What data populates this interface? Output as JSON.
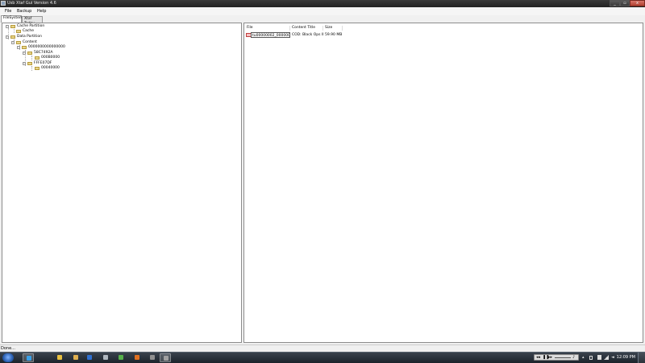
{
  "window": {
    "title": "Usb Xtaf Gui Version 4.6"
  },
  "menu": [
    "File",
    "Backup",
    "Help"
  ],
  "tabs": [
    "FileSystem",
    "Xtaf Today"
  ],
  "tree": [
    {
      "label": "Cache Partition"
    },
    {
      "label": "Cache"
    },
    {
      "label": "Data Partition"
    },
    {
      "label": "Content"
    },
    {
      "label": "0000000000000000"
    },
    {
      "label": "58C7492A"
    },
    {
      "label": "000B0000"
    },
    {
      "label": "FFFE07DF"
    },
    {
      "label": "00040000"
    }
  ],
  "file_list": {
    "columns": [
      "File",
      "Content Title",
      "Size"
    ],
    "rows": [
      {
        "file": "tu00000002_00000000",
        "title": "COD: Black Ops II",
        "size": "59.90 MB"
      }
    ]
  },
  "status": {
    "text": "Done..."
  },
  "taskbar": {
    "clock": "12:09 PM",
    "apps": [
      {
        "name": "ie-icon",
        "color": "#3aa0e8"
      },
      {
        "name": "chrome-icon",
        "color": "#e8c040"
      },
      {
        "name": "explorer-icon",
        "color": "#e0b050"
      },
      {
        "name": "media-icon",
        "color": "#3070d0"
      },
      {
        "name": "steam-icon",
        "color": "#b0b8c0"
      },
      {
        "name": "utorrent-icon",
        "color": "#56b04a"
      },
      {
        "name": "firefox-icon",
        "color": "#e07020"
      },
      {
        "name": "tool-icon",
        "color": "#909090"
      },
      {
        "name": "xtaf-app-icon",
        "color": "#a0a0a0"
      }
    ]
  }
}
